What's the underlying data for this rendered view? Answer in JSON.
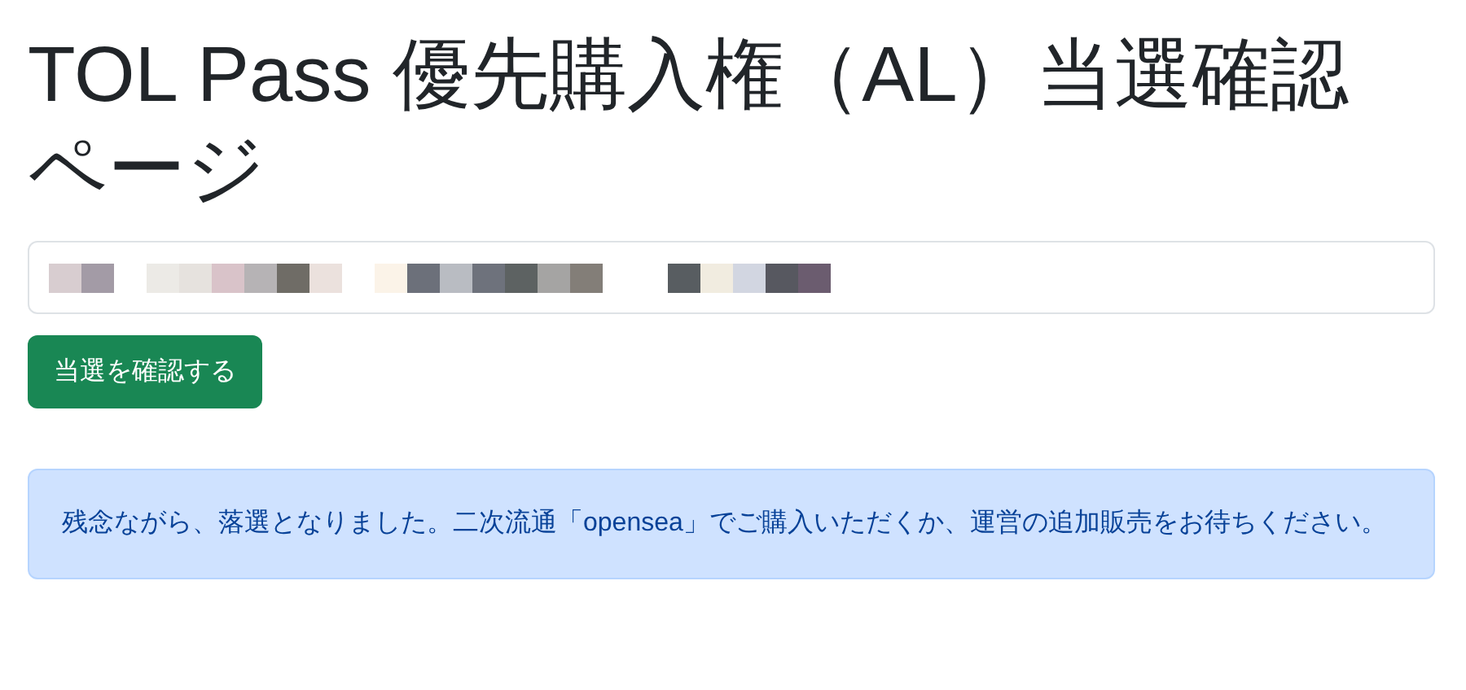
{
  "title": "TOL Pass 優先購入権（AL）当選確認ページ",
  "button": "当選を確認する",
  "alert": "残念ながら、落選となりました。二次流通「opensea」でご購入いただくか、運営の追加販売をお待ちください。"
}
